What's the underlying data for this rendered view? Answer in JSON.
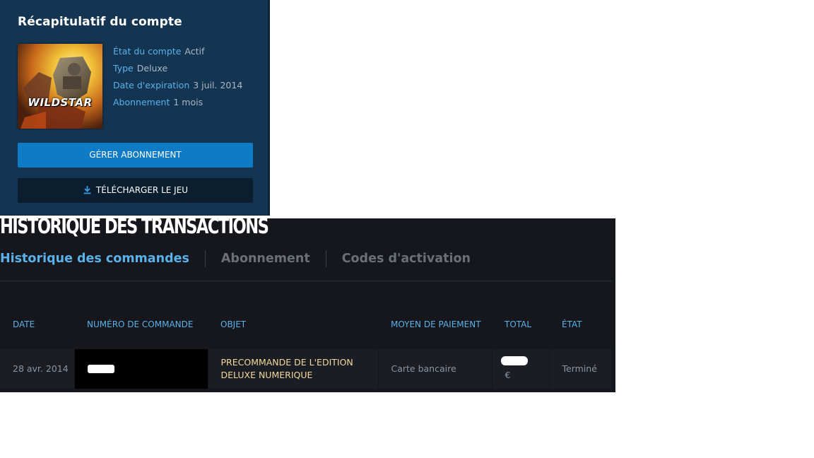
{
  "summary": {
    "title": "Récapitulatif du compte",
    "game_logo_text": "WILDSTAR",
    "rows": [
      {
        "label": "État du compte",
        "value": "Actif"
      },
      {
        "label": "Type",
        "value": "Deluxe"
      },
      {
        "label": "Date d'expiration",
        "value": "3 juil. 2014"
      },
      {
        "label": "Abonnement",
        "value": "1 mois"
      }
    ],
    "manage_button": "GÉRER ABONNEMENT",
    "download_button": "TÉLÉCHARGER LE JEU"
  },
  "history": {
    "title": "HISTORIQUE DES TRANSACTIONS",
    "tabs": [
      {
        "label": "Historique des commandes",
        "active": true
      },
      {
        "label": "Abonnement",
        "active": false
      },
      {
        "label": "Codes d'activation",
        "active": false
      }
    ],
    "columns": [
      "DATE",
      "NUMÉRO DE COMMANDE",
      "OBJET",
      "MOYEN DE PAIEMENT",
      "TOTAL",
      "ÉTAT"
    ],
    "rows": [
      {
        "date": "28 avr. 2014",
        "object": "PRECOMMANDE DE L'EDITION DELUXE NUMERIQUE",
        "payment": "Carte bancaire",
        "total_currency": "€",
        "status": "Terminé"
      }
    ]
  },
  "colors": {
    "summary_bg": "#143552",
    "accent_blue": "#5ab1ea",
    "button_blue": "#0f7ac6",
    "history_bg": "#15171c",
    "object_gold": "#f4d99c"
  },
  "icons": {
    "download": "download-icon",
    "cover": "wildstar-cover-art"
  }
}
